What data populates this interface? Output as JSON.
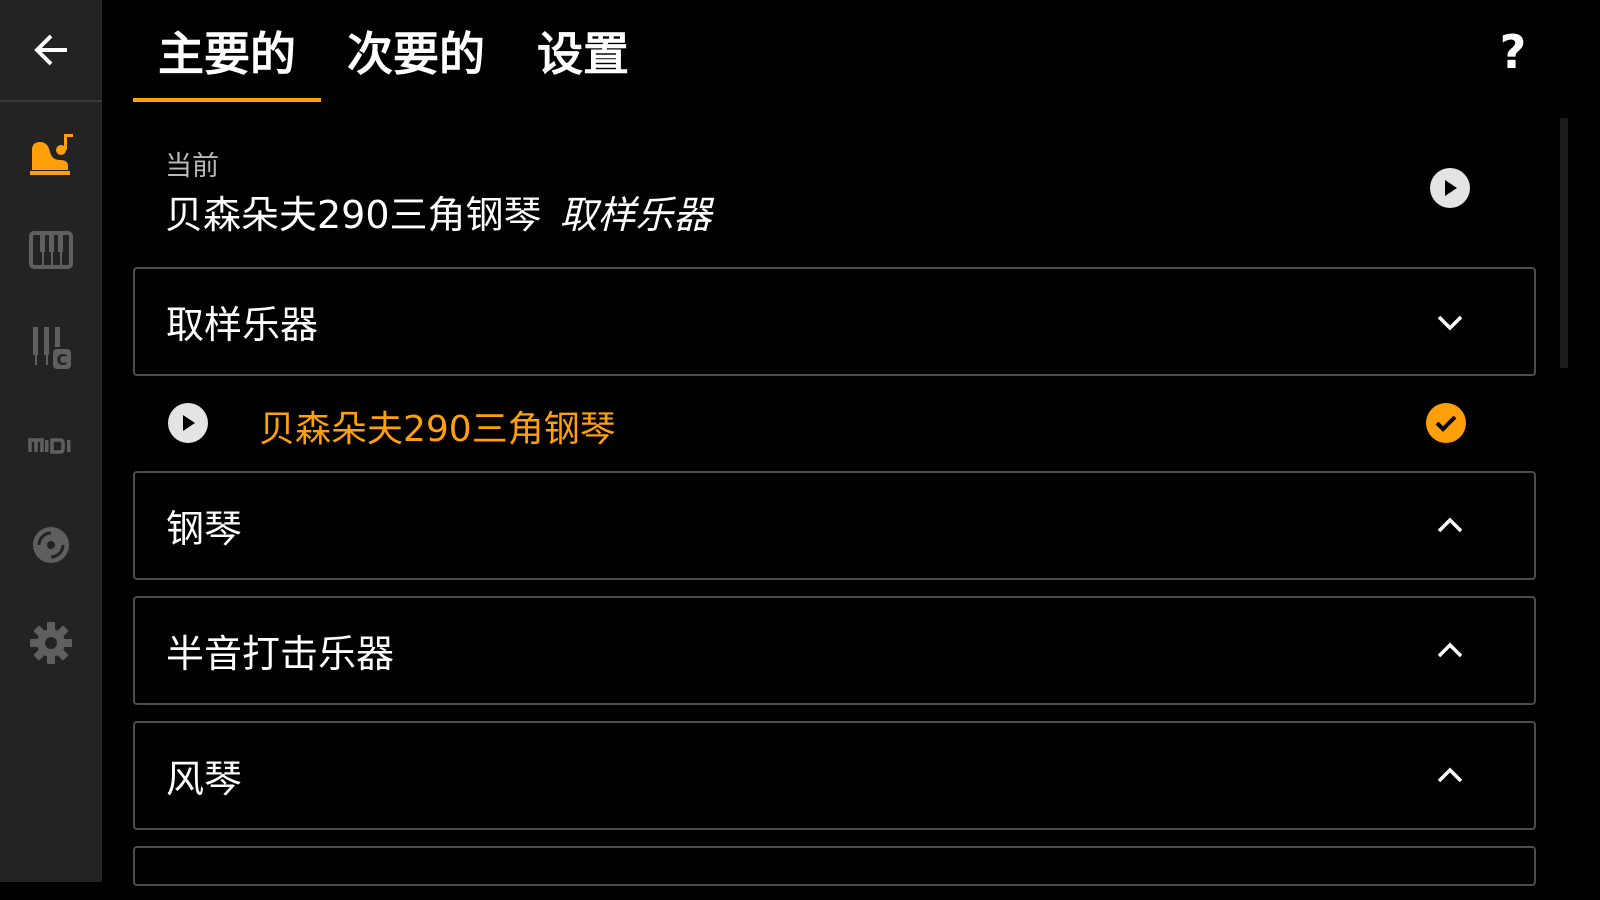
{
  "colors": {
    "accent": "#ff9f0a",
    "sidebar_bg": "#232323",
    "background": "#000000",
    "icon_gray": "#5f5f5f"
  },
  "sidebar": {
    "back_icon": "arrow-left-icon",
    "items": [
      {
        "icon": "grand-piano-note-icon",
        "active": true
      },
      {
        "icon": "piano-keys-icon",
        "active": false
      },
      {
        "icon": "keys-c-icon",
        "active": false
      },
      {
        "icon": "midi-icon",
        "active": false
      },
      {
        "icon": "disc-icon",
        "active": false
      },
      {
        "icon": "gear-icon",
        "active": false
      }
    ]
  },
  "tabs": [
    {
      "label": "主要的",
      "active": true
    },
    {
      "label": "次要的",
      "active": false
    },
    {
      "label": "设置",
      "active": false
    }
  ],
  "help_label": "?",
  "current": {
    "label": "当前",
    "instrument": "贝森朵夫290三角钢琴",
    "category": "取样乐器"
  },
  "categories": [
    {
      "label": "取样乐器",
      "expanded": true,
      "chevron": "chevron-down-icon"
    },
    {
      "label": "钢琴",
      "expanded": false,
      "chevron": "chevron-up-icon"
    },
    {
      "label": "半音打击乐器",
      "expanded": false,
      "chevron": "chevron-up-icon"
    },
    {
      "label": "风琴",
      "expanded": false,
      "chevron": "chevron-up-icon"
    }
  ],
  "selected_instrument": {
    "name": "贝森朵夫290三角钢琴",
    "selected": true
  }
}
